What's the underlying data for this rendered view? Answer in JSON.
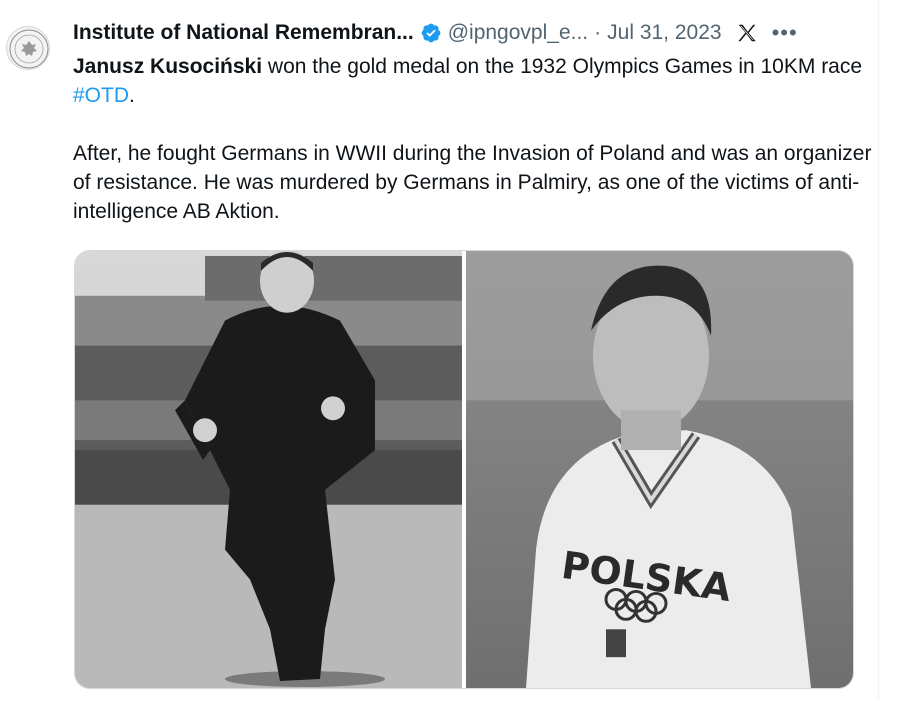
{
  "tweet": {
    "author": {
      "name": "Institute of National Remembran...",
      "handle": "@ipngovpl_e...",
      "verified": true
    },
    "separator": "·",
    "date": "Jul 31, 2023",
    "more_icon": "more-horizontal-icon",
    "platform_icon": "x-logo-icon",
    "text": {
      "mention": "Janusz Kusociński",
      "part1": " won the gold medal on the 1932 Olympics Games in 10KM race ",
      "hashtag": "#OTD",
      "part1_end": ".",
      "paragraph2": "After, he fought Germans in WWII during the Invasion of Poland and was an organizer of resistance. He was murdered by Germans in Palmiry, as one of the victims of anti-intelligence AB Aktion."
    },
    "media": {
      "photo_right_jersey_text": "POLSKA"
    }
  },
  "colors": {
    "text": "#0f1419",
    "secondary": "#536471",
    "link": "#1d9bf0",
    "verified": "#1d9bf0"
  }
}
